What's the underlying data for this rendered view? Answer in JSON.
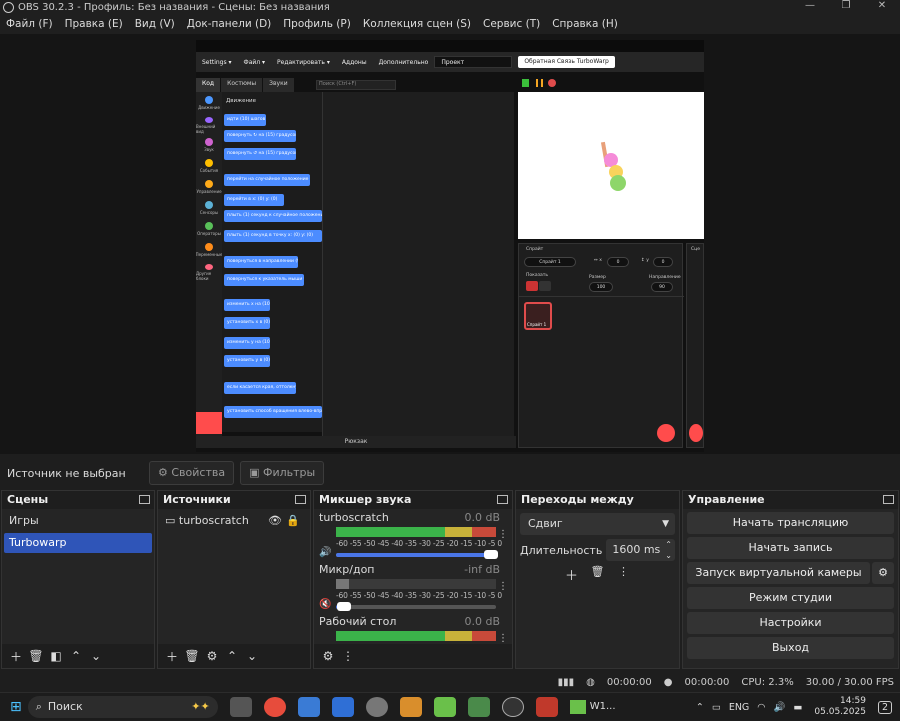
{
  "window": {
    "title": "OBS 30.2.3 - Профиль: Без названия - Сцены: Без названия"
  },
  "menu": [
    "Файл (F)",
    "Правка (E)",
    "Вид (V)",
    "Док-панели (D)",
    "Профиль (P)",
    "Коллекция сцен (S)",
    "Сервис (T)",
    "Справка (H)"
  ],
  "preview": {
    "tw_menu": {
      "settings": "Settings ▾",
      "file": "Файл ▾",
      "edit": "Редактировать ▾",
      "addons": "Аддоны",
      "more": "Дополнительно",
      "project": "Проект",
      "feedback": "Обратная Связь TurboWarp"
    },
    "tabs": [
      "Код",
      "Костюмы",
      "Звуки"
    ],
    "search": "Поиск (Ctrl+F)",
    "categories": [
      {
        "label": "Движение",
        "color": "#4c97ff"
      },
      {
        "label": "Внешний вид",
        "color": "#9966ff"
      },
      {
        "label": "Звук",
        "color": "#cf63cf"
      },
      {
        "label": "События",
        "color": "#ffbf00"
      },
      {
        "label": "Управление",
        "color": "#ffab19"
      },
      {
        "label": "Сенсоры",
        "color": "#5cb1d6"
      },
      {
        "label": "Операторы",
        "color": "#59c059"
      },
      {
        "label": "Переменные",
        "color": "#ff8c1a"
      },
      {
        "label": "Другие блоки",
        "color": "#ff6680"
      }
    ],
    "blocks_title": "Движение",
    "blocks": [
      "идти (10) шагов",
      "повернуть ↻ на (15) градусов",
      "повернуть ↺ на (15) градусов",
      "перейти на случайное положение ▾",
      "перейти в x: (0) y: (0)",
      "плыть (1) секунд к случайное положение",
      "плыть (1) секунд в точку x: (0) y: (0)",
      "повернуться в направлении (90)",
      "повернуться к указатель мыши ▾",
      "изменить x на (10)",
      "установить x в (0)",
      "изменить y на (10)",
      "установить y в (0)",
      "если касается края, оттолкнуться",
      "установить способ вращения влево-вправо"
    ],
    "bottom_label": "Рюкзак",
    "sprite": {
      "label": "Спрайт",
      "name": "Спрайт 1",
      "x": "0",
      "y": "0",
      "show_label": "Показать",
      "size_label": "Размер",
      "size": "100",
      "direction_label": "Направление",
      "direction": "90",
      "thumb_label": "Спрайт 1"
    },
    "stage_label": "Сце"
  },
  "properties_bar": {
    "no_source": "Источник не выбран",
    "properties": "Свойства",
    "filters": "Фильтры"
  },
  "scenes": {
    "title": "Сцены",
    "items": [
      "Игры",
      "Turbowarp"
    ],
    "selected": 1
  },
  "sources": {
    "title": "Источники",
    "items": [
      "turboscratch"
    ]
  },
  "mixer": {
    "title": "Микшер звука",
    "scale": "-60 -55 -50 -45 -40 -35 -30 -25 -20 -15 -10 -5 0",
    "channels": [
      {
        "name": "turboscratch",
        "db": "0.0 dB",
        "muted": false,
        "level": 1.0
      },
      {
        "name": "Микр/доп",
        "db": "-inf dB",
        "muted": true,
        "level": 0.08
      },
      {
        "name": "Рабочий стол",
        "db": "0.0 dB",
        "muted": false,
        "level": 1.0
      }
    ]
  },
  "transitions": {
    "title": "Переходы между сценами",
    "selected": "Сдвиг",
    "duration_label": "Длительность",
    "duration": "1600 ms"
  },
  "controls": {
    "title": "Управление",
    "buttons": [
      "Начать трансляцию",
      "Начать запись",
      "Запуск виртуальной камеры",
      "Режим студии",
      "Настройки",
      "Выход"
    ]
  },
  "status": {
    "stream_time": "00:00:00",
    "rec_time": "00:00:00",
    "cpu": "CPU: 2.3%",
    "fps": "30.00 / 30.00 FPS"
  },
  "taskbar": {
    "search": "Поиск",
    "active_app": "W1...",
    "lang": "ENG",
    "time": "14:59",
    "date": "05.05.2025",
    "notifications": "2"
  }
}
